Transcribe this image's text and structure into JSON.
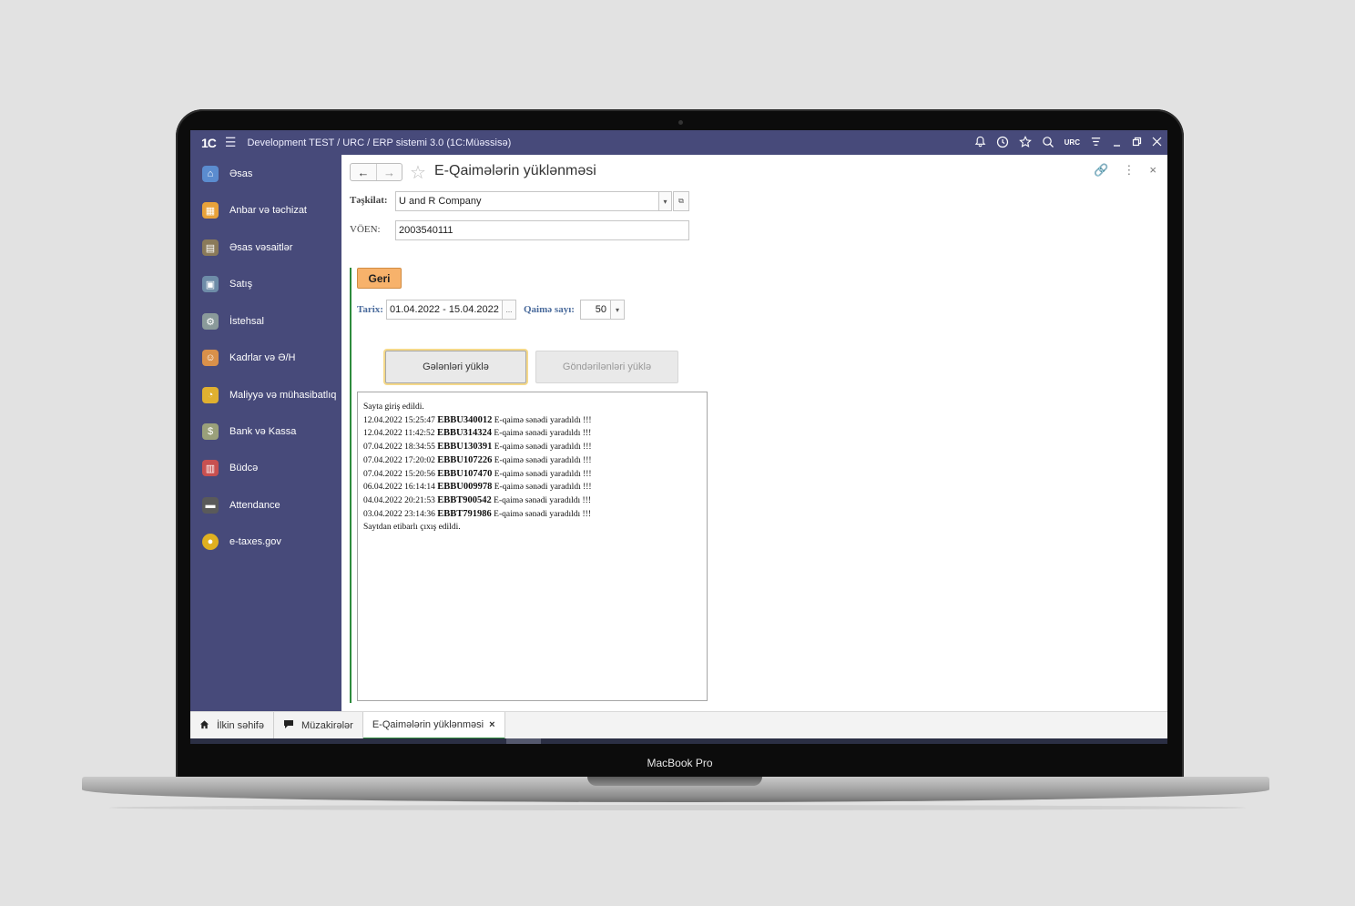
{
  "device": {
    "brand": "MacBook Pro"
  },
  "titlebar": {
    "logo": "1С",
    "menu_icon": "☰",
    "title": "Development TEST / URC / ERP sistemi 3.0  (1C:Müəssisə)",
    "user": "URC",
    "icons": [
      "bell-icon",
      "history-icon",
      "star-icon",
      "search-icon",
      "settings-icon",
      "minimize-icon",
      "restore-icon",
      "close-icon"
    ]
  },
  "sidebar": {
    "items": [
      {
        "label": "Əsas",
        "icon": "home-icon",
        "color": "#5b8ccf"
      },
      {
        "label": "Anbar və təchizat",
        "icon": "boxes-icon",
        "color": "#e8a23a"
      },
      {
        "label": "Əsas vəsaitlər",
        "icon": "assets-icon",
        "color": "#8a7a5a"
      },
      {
        "label": "Satış",
        "icon": "cash-register-icon",
        "color": "#6e8ca8"
      },
      {
        "label": "İstehsal",
        "icon": "factory-icon",
        "color": "#8a9a9a"
      },
      {
        "label": "Kadrlar və Ə/H",
        "icon": "people-icon",
        "color": "#d9904a"
      },
      {
        "label": "Maliyyə və mühasibatlıq",
        "icon": "finance-icon",
        "color": "#e0b030"
      },
      {
        "label": "Bank və Kassa",
        "icon": "bank-icon",
        "color": "#9aa07a"
      },
      {
        "label": "Büdcə",
        "icon": "budget-icon",
        "color": "#c85050"
      },
      {
        "label": "Attendance",
        "icon": "attendance-icon",
        "color": "#5a5a5a"
      },
      {
        "label": "e-taxes.gov",
        "icon": "taxes-icon",
        "color": "#e0b020"
      }
    ]
  },
  "form": {
    "title": "E-Qaimələrin yüklənməsi",
    "back": "←",
    "forward": "→",
    "star": "☆",
    "tools": [
      "link-icon",
      "more-icon",
      "close-icon"
    ],
    "tools_glyphs": [
      "🔗",
      "⋮",
      "×"
    ],
    "org_label": "Təşkilat:",
    "org_value": "U and R Company",
    "voen_label": "VÖEN:",
    "voen_value": "2003540111",
    "geri_label": "Geri",
    "date_label": "Tarix:",
    "date_value": "01.04.2022 - 15.04.2022",
    "date_btn": "...",
    "count_label": "Qaimə sayı:",
    "count_value": "50",
    "incoming_btn": "Gələnləri yüklə",
    "outgoing_btn": "Göndərilənləri yüklə"
  },
  "log": {
    "first": "Sayta giriş edildi.",
    "entries": [
      {
        "ts": "12.04.2022 15:25:47",
        "code": "EBBU340012",
        "msg": "E-qaimə sənədi yaradıldı !!!"
      },
      {
        "ts": "12.04.2022 11:42:52",
        "code": "EBBU314324",
        "msg": "E-qaimə sənədi yaradıldı !!!"
      },
      {
        "ts": "07.04.2022 18:34:55",
        "code": "EBBU130391",
        "msg": "E-qaimə sənədi yaradıldı !!!"
      },
      {
        "ts": "07.04.2022 17:20:02",
        "code": "EBBU107226",
        "msg": "E-qaimə sənədi yaradıldı !!!"
      },
      {
        "ts": "07.04.2022 15:20:56",
        "code": "EBBU107470",
        "msg": "E-qaimə sənədi yaradıldı !!!"
      },
      {
        "ts": "06.04.2022 16:14:14",
        "code": "EBBU009978",
        "msg": "E-qaimə sənədi yaradıldı !!!"
      },
      {
        "ts": "04.04.2022 20:21:53",
        "code": "EBBT900542",
        "msg": "E-qaimə sənədi yaradıldı !!!"
      },
      {
        "ts": "03.04.2022 23:14:36",
        "code": "EBBT791986",
        "msg": "E-qaimə sənədi yaradıldı !!!"
      }
    ],
    "last": "Saytdan etibarlı çıxış edildi."
  },
  "bottom_tabs": [
    {
      "label": "İlkin səhifə",
      "icon": "home-icon"
    },
    {
      "label": "Müzakirələr",
      "icon": "chat-icon"
    },
    {
      "label": "E-Qaimələrin yüklənməsi",
      "icon": "",
      "close": "×"
    }
  ]
}
